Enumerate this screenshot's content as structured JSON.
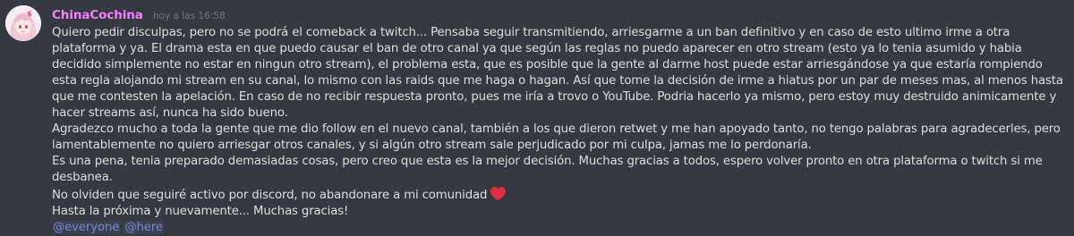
{
  "message": {
    "username": "ChinaCochina",
    "timestamp": "hoy a las 16:58",
    "username_color": "#f47fff",
    "avatar_icon": "anime-girl-avatar",
    "paragraphs": [
      "Quiero pedir disculpas, pero no se podrá el comeback a twitch... Pensaba seguir transmitiendo, arriesgarme a un ban definitivo y en caso de esto ultimo irme a otra plataforma y ya. El drama esta en que puedo causar el ban de otro canal ya que según las reglas no puedo aparecer en otro stream (esto ya lo tenia asumido y habia decidido simplemente no estar en ningun otro stream), el problema esta, que es posible que la gente al darme host puede estar arriesgándose ya que estaría rompiendo esta regla alojando mi stream en su canal, lo mismo con las raids que me haga o hagan. Así que tome la decisión de irme a hiatus por un par de meses mas, al menos hasta que me contesten la apelación. En caso de no recibir respuesta pronto, pues me iría a trovo o YouTube. Podria hacerlo ya mismo, pero estoy muy destruido animicamente y hacer streams así, nunca ha sido bueno.",
      "Agradezco mucho a toda la gente que me dio follow en el nuevo canal, también a los que dieron retwet y me han apoyado tanto, no tengo palabras para agradecerles, pero lamentablemente no quiero arriesgar otros canales, y si algún otro stream sale perjudicado por mi culpa, jamas me lo perdonaría.",
      "Es una pena, tenia preparado demasiadas cosas, pero creo que esta es la mejor decisión. Muchas gracias a todos, espero volver pronto en otra plataforma o twitch si me desbanea.",
      "No olviden que seguiré activo por discord, no abandonare a mi comunidad",
      "Hasta la próxima y nuevamente... Muchas gracias!"
    ],
    "heart_emoji_icon": "red-heart-icon",
    "mentions": [
      "@everyone",
      "@here"
    ],
    "mention_color": "#7289da"
  }
}
